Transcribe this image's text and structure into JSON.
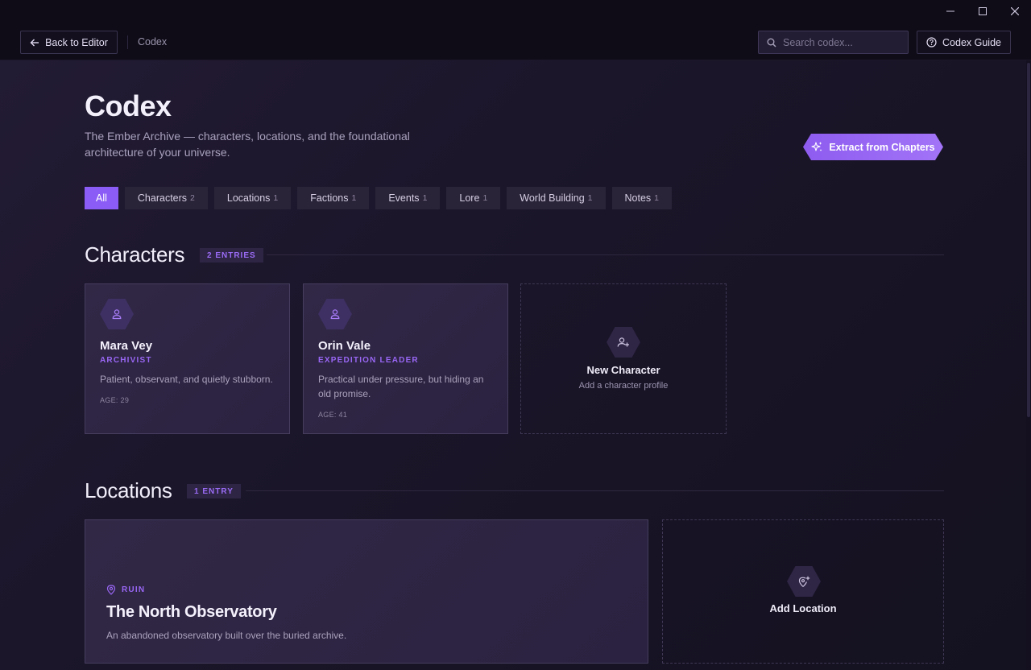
{
  "header": {
    "back_label": "Back to Editor",
    "breadcrumb": "Codex",
    "search_placeholder": "Search codex...",
    "guide_label": "Codex Guide"
  },
  "page": {
    "title": "Codex",
    "description": "The Ember Archive — characters, locations, and the foundational architecture of your universe.",
    "extract_label": "Extract from Chapters"
  },
  "tabs": [
    {
      "label": "All",
      "count": ""
    },
    {
      "label": "Characters",
      "count": "2"
    },
    {
      "label": "Locations",
      "count": "1"
    },
    {
      "label": "Factions",
      "count": "1"
    },
    {
      "label": "Events",
      "count": "1"
    },
    {
      "label": "Lore",
      "count": "1"
    },
    {
      "label": "World Building",
      "count": "1"
    },
    {
      "label": "Notes",
      "count": "1"
    }
  ],
  "characters": {
    "title": "Characters",
    "badge": "2 ENTRIES",
    "items": [
      {
        "name": "Mara Vey",
        "role": "ARCHIVIST",
        "desc": "Patient, observant, and quietly stubborn.",
        "age": "AGE: 29"
      },
      {
        "name": "Orin Vale",
        "role": "EXPEDITION LEADER",
        "desc": "Practical under pressure, but hiding an old promise.",
        "age": "AGE: 41"
      }
    ],
    "new_title": "New Character",
    "new_sub": "Add a character profile"
  },
  "locations": {
    "title": "Locations",
    "badge": "1 ENTRY",
    "items": [
      {
        "type": "RUIN",
        "name": "The North Observatory",
        "desc": "An abandoned observatory built over the buried archive."
      }
    ],
    "add_title": "Add Location"
  },
  "colors": {
    "accent": "#8b5cf6",
    "background": "#171322",
    "card": "#2e2543"
  }
}
